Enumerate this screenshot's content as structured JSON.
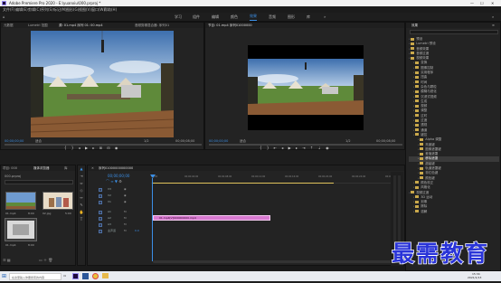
{
  "app": {
    "title": "Adobe Premiere Pro 2020 - E:\\yuanxiu\\000.prproj *",
    "window_controls": [
      "—",
      "☐",
      "✕"
    ]
  },
  "menu": [
    "文件(F)",
    "编辑(E)",
    "剪辑(C)",
    "序列(S)",
    "标记(M)",
    "图形(G)",
    "视图(V)",
    "窗口(W)",
    "帮助(H)"
  ],
  "workspaces": [
    "学习",
    "组件",
    "编辑",
    "颜色",
    "效果",
    "音频",
    "图形",
    "库"
  ],
  "active_workspace": "效果",
  "source_monitor": {
    "tabs": [
      "元数据",
      "Lumetri 范围",
      "源: 01.mp4 序列 01: 00.mp4",
      "音频剪辑混合器: 序列01"
    ],
    "timecode_in": "00;00;00;00",
    "fit": "适合",
    "ratio": "1/2",
    "timecode_out": "00;00;08;00"
  },
  "program_monitor": {
    "tab": "节目: 01.mp4 序列01000000",
    "timecode_in": "00;00;00;00",
    "fit": "适合",
    "ratio": "1/2",
    "timecode_out": "00;00;08;00"
  },
  "effects_panel": {
    "title": "效果",
    "items": [
      {
        "label": "预设",
        "indent": 0
      },
      {
        "label": "Lumetri 预设",
        "indent": 0
      },
      {
        "label": "音频效果",
        "indent": 0
      },
      {
        "label": "音频过渡",
        "indent": 0
      },
      {
        "label": "视频效果",
        "indent": 0
      },
      {
        "label": "变换",
        "indent": 1
      },
      {
        "label": "图像控制",
        "indent": 1
      },
      {
        "label": "实用程序",
        "indent": 1
      },
      {
        "label": "扭曲",
        "indent": 1
      },
      {
        "label": "时间",
        "indent": 1
      },
      {
        "label": "杂色与颗粒",
        "indent": 1
      },
      {
        "label": "模糊与锐化",
        "indent": 1
      },
      {
        "label": "沉浸式视频",
        "indent": 1
      },
      {
        "label": "生成",
        "indent": 1
      },
      {
        "label": "视频",
        "indent": 1
      },
      {
        "label": "调整",
        "indent": 1
      },
      {
        "label": "过时",
        "indent": 1
      },
      {
        "label": "过渡",
        "indent": 1
      },
      {
        "label": "透视",
        "indent": 1
      },
      {
        "label": "通道",
        "indent": 1
      },
      {
        "label": "键控",
        "indent": 1
      },
      {
        "label": "Alpha 调整",
        "indent": 2
      },
      {
        "label": "亮度键",
        "indent": 2
      },
      {
        "label": "图像遮罩键",
        "indent": 2
      },
      {
        "label": "差值遮罩",
        "indent": 2
      },
      {
        "label": "移除遮罩",
        "indent": 2
      },
      {
        "label": "超级键",
        "indent": 2
      },
      {
        "label": "轨道遮罩键",
        "indent": 2
      },
      {
        "label": "非红色键",
        "indent": 2
      },
      {
        "label": "颜色键",
        "indent": 2
      },
      {
        "label": "颜色校正",
        "indent": 1
      },
      {
        "label": "风格化",
        "indent": 1
      },
      {
        "label": "视频过渡",
        "indent": 0
      },
      {
        "label": "3D 运动",
        "indent": 1
      },
      {
        "label": "划像",
        "indent": 1
      },
      {
        "label": "擦除",
        "indent": 1
      },
      {
        "label": "溶解",
        "indent": 1
      }
    ],
    "highlight_index": 25
  },
  "project_panel": {
    "tabs": [
      "项目: 000",
      "媒体浏览器",
      "库"
    ],
    "path": "000.prproj",
    "clips": [
      {
        "name": "01.mp4",
        "duration": "8:00"
      },
      {
        "name": "02.jpg",
        "duration": "5:00"
      },
      {
        "name": "01.mp4",
        "duration": "8:00"
      }
    ]
  },
  "timeline": {
    "tab": "序列01000000000000",
    "timecode": "00;00;00;00",
    "ruler": [
      "00;00",
      "00;00;04;00",
      "00;00;08;00",
      "00;00;12;00",
      "00;00;16;00",
      "00;00;20;00",
      "00;00;24;00",
      "00;00;28;00"
    ],
    "tracks": [
      "V3",
      "V2",
      "V1",
      "A1",
      "A2",
      "A3",
      "主声道"
    ],
    "clip_label": "01.mp4[V]000000000.mp4",
    "master_value": "0.0"
  },
  "taskbar": {
    "search": "在这里输入你要搜索的内容",
    "time": "15:34",
    "date": "2021/1/13"
  },
  "watermark": "最需教育"
}
